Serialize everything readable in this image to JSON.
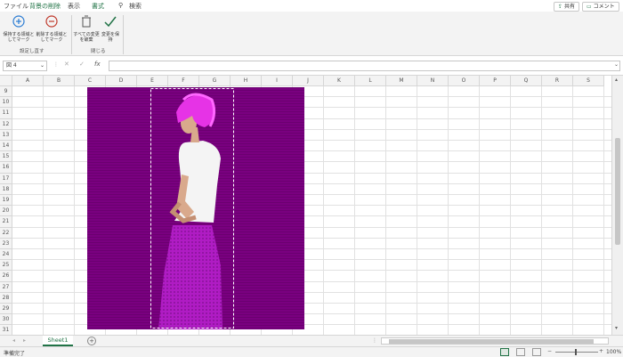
{
  "tabs": {
    "file": "ファイル",
    "remove_bg": "背景の削除",
    "view": "表示",
    "format": "書式",
    "search": "検索"
  },
  "top_buttons": {
    "share": "共有",
    "comment": "コメント"
  },
  "ribbon": {
    "mark_keep": "保持する領域としてマーク",
    "mark_remove": "削除する領域としてマーク",
    "discard": "すべての変更を破棄",
    "keep": "変更を保持",
    "group_refine": "設定し直す",
    "group_close": "閉じる"
  },
  "formula_bar": {
    "name_box": "図 4",
    "formula": ""
  },
  "columns": [
    "A",
    "B",
    "C",
    "D",
    "E",
    "F",
    "G",
    "H",
    "I",
    "J",
    "K",
    "L",
    "M",
    "N",
    "O",
    "P",
    "Q",
    "R",
    "S"
  ],
  "rows": [
    "9",
    "10",
    "11",
    "12",
    "13",
    "14",
    "15",
    "16",
    "17",
    "18",
    "19",
    "20",
    "21",
    "22",
    "23",
    "24",
    "25",
    "26",
    "27",
    "28",
    "29",
    "30",
    "31"
  ],
  "sheet_tab": "Sheet1",
  "status": {
    "ready": "準備完了",
    "zoom": "100%"
  },
  "colors": {
    "accent": "#217346",
    "image_bg": "#7a0080",
    "hair": "#e633e6",
    "skirt": "#b01cc4"
  }
}
